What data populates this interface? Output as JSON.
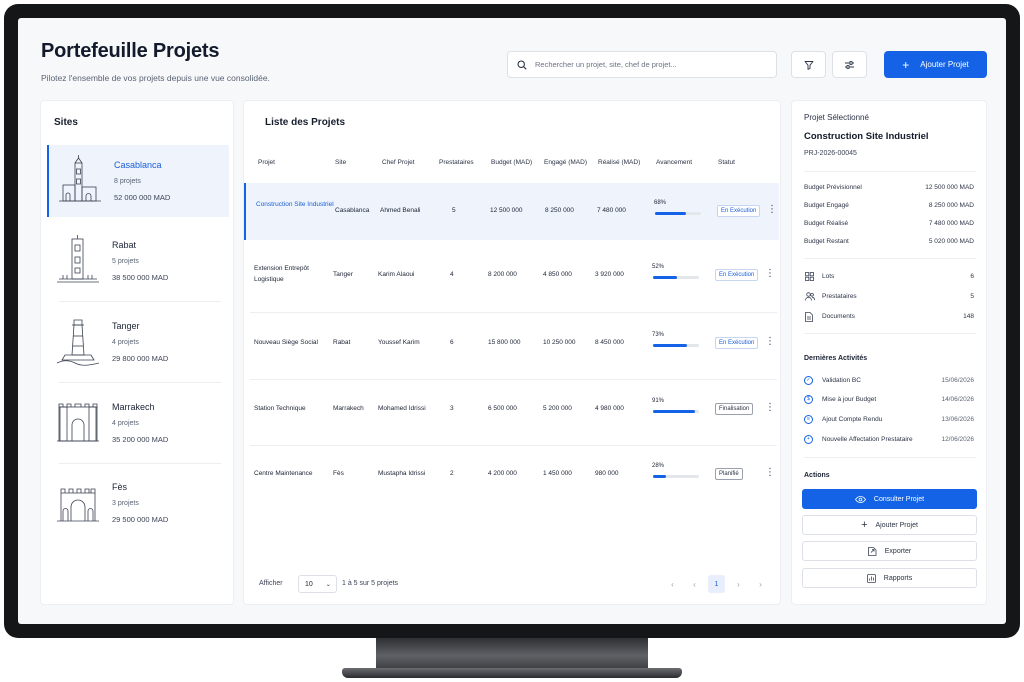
{
  "header": {
    "title": "Portefeuille Projets",
    "subtitle": "Pilotez l'ensemble de vos projets depuis une vue consolidée.",
    "search_placeholder": "Rechercher un projet, site, chef de projet...",
    "add_button": "Ajouter Projet"
  },
  "sites": {
    "title": "Sites",
    "items": [
      {
        "name": "Casablanca",
        "count": "8 projets",
        "budget": "52 000 000 MAD",
        "icon": "hassan-ii-mosque-illustration"
      },
      {
        "name": "Rabat",
        "count": "5 projets",
        "budget": "38 500 000 MAD",
        "icon": "hassan-tower-illustration"
      },
      {
        "name": "Tanger",
        "count": "4 projets",
        "budget": "29 800 000 MAD",
        "icon": "lighthouse-illustration"
      },
      {
        "name": "Marrakech",
        "count": "4 projets",
        "budget": "35 200 000 MAD",
        "icon": "city-gate-illustration"
      },
      {
        "name": "Fès",
        "count": "3 projets",
        "budget": "29 500 000 MAD",
        "icon": "bab-gate-illustration"
      }
    ]
  },
  "projects": {
    "title": "Liste des Projets",
    "columns": [
      "Projet",
      "Site",
      "Chef Projet",
      "Prestataires",
      "Budget (MAD)",
      "Engagé (MAD)",
      "Réalisé (MAD)",
      "Avancement",
      "Statut"
    ],
    "rows": [
      {
        "projet": "Construction Site Industriel",
        "site": "Casablanca",
        "chef": "Ahmed Benali",
        "prestataires": "5",
        "budget": "12 500 000",
        "engage": "8 250 000",
        "realise": "7 480 000",
        "avancement_label": "68%",
        "avancement": 0.68,
        "statut": "En Exécution"
      },
      {
        "projet": "Extension Entrepôt Logistique",
        "site": "Tanger",
        "chef": "Karim Alaoui",
        "prestataires": "4",
        "budget": "8 200 000",
        "engage": "4 850 000",
        "realise": "3 920 000",
        "avancement_label": "52%",
        "avancement": 0.52,
        "statut": "En Exécution"
      },
      {
        "projet": "Nouveau Siège Social",
        "site": "Rabat",
        "chef": "Youssef Karim",
        "prestataires": "6",
        "budget": "15 800 000",
        "engage": "10 250 000",
        "realise": "8 450 000",
        "avancement_label": "73%",
        "avancement": 0.73,
        "statut": "En Exécution"
      },
      {
        "projet": "Station Technique",
        "site": "Marrakech",
        "chef": "Mohamed Idrissi",
        "prestataires": "3",
        "budget": "6 500 000",
        "engage": "5 200 000",
        "realise": "4 980 000",
        "avancement_label": "91%",
        "avancement": 0.91,
        "statut": "Finalisation"
      },
      {
        "projet": "Centre Maintenance",
        "site": "Fès",
        "chef": "Mustapha Idrissi",
        "prestataires": "2",
        "budget": "4 200 000",
        "engage": "1 450 000",
        "realise": "980 000",
        "avancement_label": "28%",
        "avancement": 0.28,
        "statut": "Planifié"
      }
    ],
    "pagination": {
      "show_label": "Afficher",
      "page_size": "10",
      "summary": "1 à 5 sur 5 projets",
      "current_page": "1"
    }
  },
  "detail": {
    "section_title": "Projet Sélectionné",
    "project_name": "Construction Site Industriel",
    "project_code": "PRJ-2026-00045",
    "budgets": [
      {
        "label": "Budget Prévisionnel",
        "value": "12 500 000 MAD"
      },
      {
        "label": "Budget Engagé",
        "value": "8 250 000 MAD"
      },
      {
        "label": "Budget Réalisé",
        "value": "7 480 000 MAD"
      },
      {
        "label": "Budget Restant",
        "value": "5 020 000 MAD"
      }
    ],
    "stats": [
      {
        "label": "Lots",
        "value": "6",
        "icon": "lots-icon"
      },
      {
        "label": "Prestataires",
        "value": "5",
        "icon": "users-icon"
      },
      {
        "label": "Documents",
        "value": "148",
        "icon": "document-icon"
      }
    ],
    "activities_title": "Dernières Activités",
    "activities": [
      {
        "label": "Validation BC",
        "date": "15/06/2026",
        "icon": "check-circle-icon"
      },
      {
        "label": "Mise à jour Budget",
        "date": "14/06/2026",
        "icon": "currency-circle-icon"
      },
      {
        "label": "Ajout Compte Rendu",
        "date": "13/06/2026",
        "icon": "document-circle-icon"
      },
      {
        "label": "Nouvelle Affectation Prestataire",
        "date": "12/06/2026",
        "icon": "user-plus-circle-icon"
      }
    ],
    "actions_title": "Actions",
    "actions": {
      "consult": "Consulter Projet",
      "add": "Ajouter Projet",
      "export": "Exporter",
      "reports": "Rapports"
    }
  },
  "colors": {
    "accent": "#1463e6",
    "accent_light": "#eef3fc",
    "text": "#1b2333"
  }
}
